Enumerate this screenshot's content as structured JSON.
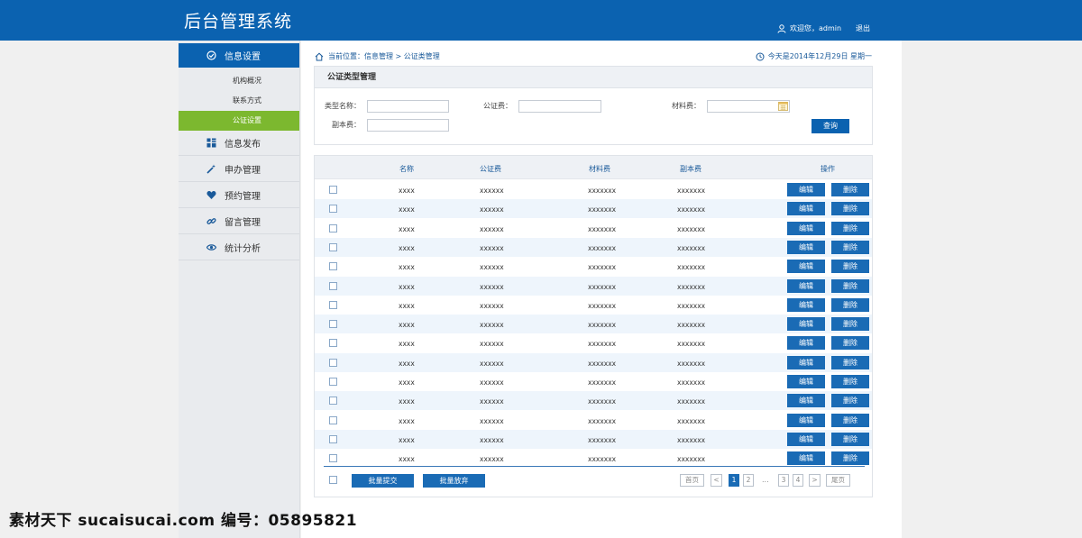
{
  "header": {
    "title": "后台管理系统",
    "welcome": "欢迎您，admin",
    "logout": "退出"
  },
  "sidebar": {
    "active_group": "信息设置",
    "sub_items": [
      "机构概况",
      "联系方式",
      "公证设置"
    ],
    "active_sub": "公证设置",
    "menu": [
      {
        "label": "信息发布",
        "icon": "grid-icon"
      },
      {
        "label": "申办管理",
        "icon": "magic-wand-icon"
      },
      {
        "label": "预约管理",
        "icon": "heart-icon"
      },
      {
        "label": "留言管理",
        "icon": "link-icon"
      },
      {
        "label": "统计分析",
        "icon": "eye-icon"
      }
    ]
  },
  "breadcrumb": "当前位置：信息管理 > 公证类管理",
  "date_text": "今天是2014年12月29日 星期一",
  "search": {
    "title": "公证类型管理",
    "fields": {
      "type_name": {
        "label": "类型名称：",
        "value": ""
      },
      "notary_fee": {
        "label": "公证费：",
        "value": ""
      },
      "material_fee": {
        "label": "材料费：",
        "value": ""
      },
      "copy_fee": {
        "label": "副本费：",
        "value": ""
      }
    },
    "query_button": "查询"
  },
  "table": {
    "columns": [
      "名称",
      "公证费",
      "材料费",
      "副本费",
      "操作"
    ],
    "rows": [
      [
        "xxxx",
        "xxxxxx",
        "xxxxxxx",
        "xxxxxxx"
      ],
      [
        "xxxx",
        "xxxxxx",
        "xxxxxxx",
        "xxxxxxx"
      ],
      [
        "xxxx",
        "xxxxxx",
        "xxxxxxx",
        "xxxxxxx"
      ],
      [
        "xxxx",
        "xxxxxx",
        "xxxxxxx",
        "xxxxxxx"
      ],
      [
        "xxxx",
        "xxxxxx",
        "xxxxxxx",
        "xxxxxxx"
      ],
      [
        "xxxx",
        "xxxxxx",
        "xxxxxxx",
        "xxxxxxx"
      ],
      [
        "xxxx",
        "xxxxxx",
        "xxxxxxx",
        "xxxxxxx"
      ],
      [
        "xxxx",
        "xxxxxx",
        "xxxxxxx",
        "xxxxxxx"
      ],
      [
        "xxxx",
        "xxxxxx",
        "xxxxxxx",
        "xxxxxxx"
      ],
      [
        "xxxx",
        "xxxxxx",
        "xxxxxxx",
        "xxxxxxx"
      ],
      [
        "xxxx",
        "xxxxxx",
        "xxxxxxx",
        "xxxxxxx"
      ],
      [
        "xxxx",
        "xxxxxx",
        "xxxxxxx",
        "xxxxxxx"
      ],
      [
        "xxxx",
        "xxxxxx",
        "xxxxxxx",
        "xxxxxxx"
      ],
      [
        "xxxx",
        "xxxxxx",
        "xxxxxxx",
        "xxxxxxx"
      ],
      [
        "xxxx",
        "xxxxxx",
        "xxxxxxx",
        "xxxxxxx"
      ]
    ],
    "edit_label": "编辑",
    "delete_label": "删除"
  },
  "footer": {
    "batch_submit": "批量提交",
    "batch_discard": "批量放弃"
  },
  "pager": {
    "first": "首页",
    "prev": "<",
    "pages": [
      "1",
      "2",
      "3",
      "4"
    ],
    "ellipsis": "...",
    "next": ">",
    "last": "尾页",
    "current": "1"
  },
  "watermark": "素材天下 sucaisucai.com  编号：05895821",
  "colors": {
    "primary": "#0b62b0",
    "active_green": "#7cb82f",
    "button_blue": "#1a6bb5"
  }
}
